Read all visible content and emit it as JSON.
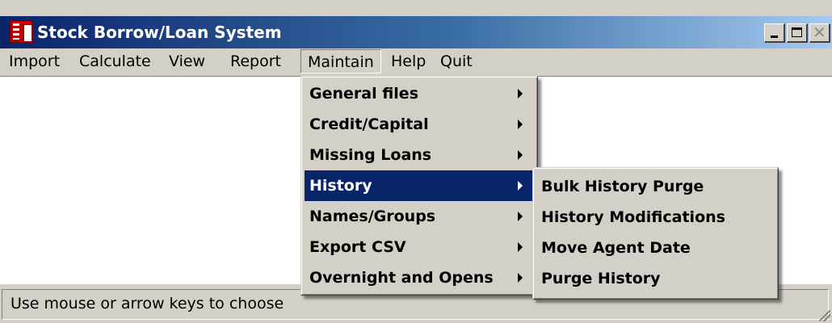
{
  "window": {
    "title": "Stock Borrow/Loan System",
    "icon": "app-logo-icon",
    "controls": [
      "minimize-icon",
      "maximize-icon",
      "close-icon"
    ]
  },
  "menubar": {
    "items": [
      {
        "label": "Import"
      },
      {
        "label": "Calculate"
      },
      {
        "label": "View"
      },
      {
        "label": "Report"
      },
      {
        "label": "Maintain"
      },
      {
        "label": "Help"
      },
      {
        "label": "Quit"
      }
    ],
    "active": "Maintain"
  },
  "maintain_menu": {
    "items": [
      {
        "label": "General files",
        "submenu": true
      },
      {
        "label": "Credit/Capital",
        "submenu": true
      },
      {
        "label": "Missing Loans",
        "submenu": true
      },
      {
        "label": "History",
        "submenu": true,
        "highlighted": true
      },
      {
        "label": "Names/Groups",
        "submenu": true
      },
      {
        "label": "Export CSV",
        "submenu": true
      },
      {
        "label": "Overnight and Opens",
        "submenu": true
      }
    ]
  },
  "history_submenu": {
    "items": [
      {
        "label": "Bulk History Purge"
      },
      {
        "label": "History Modifications"
      },
      {
        "label": "Move Agent Date"
      },
      {
        "label": "Purge History"
      }
    ]
  },
  "statusbar": {
    "text": "Use mouse or arrow keys to choose"
  },
  "colors": {
    "titlebar_start": "#0a246a",
    "titlebar_end": "#a6caf0",
    "highlight": "#0a246a",
    "face": "#d4d0c8"
  }
}
